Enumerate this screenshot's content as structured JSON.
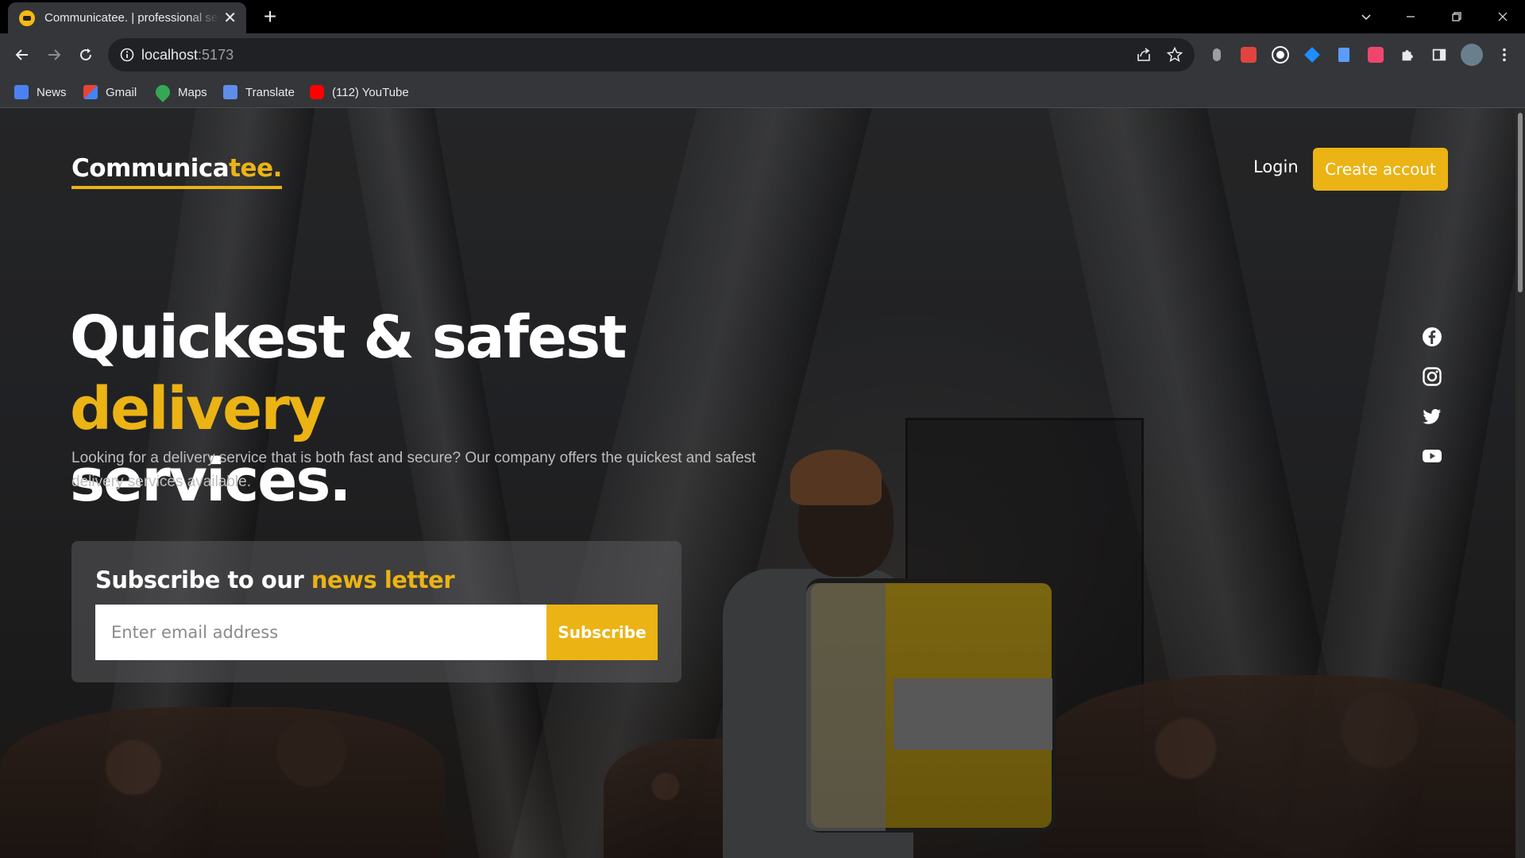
{
  "browser": {
    "tab_title": "Communicatee. | professional services",
    "url_host": "localhost",
    "url_port": ":5173",
    "bookmarks": [
      {
        "label": "News",
        "icon": "news-icon"
      },
      {
        "label": "Gmail",
        "icon": "gmail-icon"
      },
      {
        "label": "Maps",
        "icon": "maps-icon"
      },
      {
        "label": "Translate",
        "icon": "translate-icon"
      },
      {
        "label": "(112) YouTube",
        "icon": "youtube-icon"
      }
    ]
  },
  "site": {
    "logo_main": "Communica",
    "logo_accent": "tee.",
    "nav": {
      "login": "Login",
      "create_account": "Create accout"
    },
    "hero": {
      "headline_part1": "Quickest & safest ",
      "headline_accent": "delivery",
      "headline_part2": "services.",
      "description": "Looking for a delivery service that is both fast and secure? Our company offers the quickest and safest delivery services available."
    },
    "newsletter": {
      "title_main": "Subscribe to our ",
      "title_accent": "news letter",
      "email_placeholder": "Enter email address",
      "button": "Subscribe"
    },
    "socials": [
      "facebook-icon",
      "instagram-icon",
      "twitter-icon",
      "youtube-icon"
    ]
  },
  "colors": {
    "accent": "#ebb314",
    "browser_frame": "#000000",
    "toolbar": "#35363a"
  }
}
